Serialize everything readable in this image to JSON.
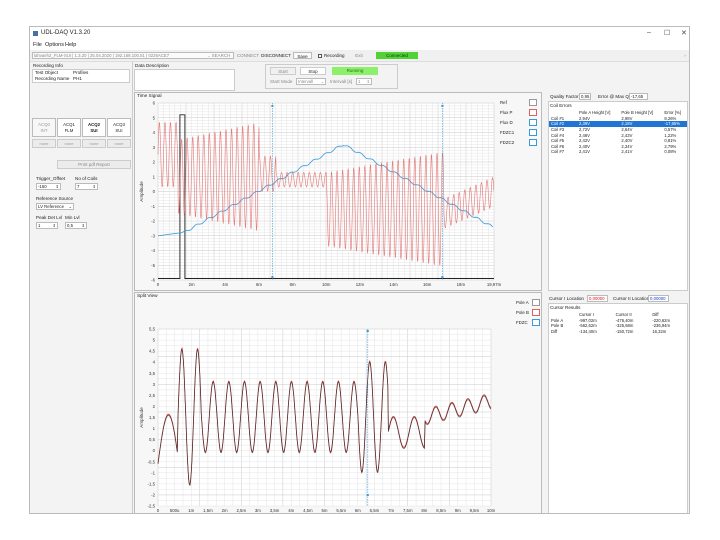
{
  "window": {
    "title": "UDL-DAQ V1.3.20",
    "min_glyph": "–",
    "max_glyph": "☐",
    "close_glyph": "✕"
  },
  "menu": [
    "File",
    "Options",
    "Help"
  ],
  "toolbar": {
    "device": "lahvaeh2_FLM-SUI | 1.3.20 | 25.04.2020 | 192.168.100.51 | 0225ACE7",
    "search": "SEARCH",
    "connect": "CONNECT",
    "disconnect": "DISCONNECT",
    "save": "Save",
    "recording": "Recording",
    "exit": "Exit",
    "status": "Connected"
  },
  "recording_info": {
    "title": "Recording Info",
    "test_object_label": "Test Object",
    "test_object_value": "Profiles",
    "recording_name_label": "Recording Name",
    "recording_name_value": "PH1"
  },
  "acq_buttons": [
    {
      "line1": "ACQ0",
      "line2": "INT"
    },
    {
      "line1": "ACQ1",
      "line2": "FLM"
    },
    {
      "line1": "ACQ2",
      "line2": "SUI"
    },
    {
      "line1": "ACQ3",
      "line2": "SUI"
    }
  ],
  "none_label": "none",
  "print_report": "Print pdf Report",
  "trigger": {
    "offset_label": "Trigger_Offset",
    "offset_value": "-150",
    "coils_label": "No of Coils",
    "coils_value": "7",
    "ref_label": "Reference Source",
    "ref_value": "LV Reference",
    "peak_label": "Peak Det Lvl",
    "peak_value": "1",
    "min_label": "Min Lvl",
    "min_value": "0,5"
  },
  "data_description_title": "Data Description",
  "controls": {
    "start": "Start",
    "stop": "Stop",
    "running": "Running",
    "start_mode_label": "Start Mode",
    "start_mode_value": "Intervall",
    "interval_label": "Intervall [s]",
    "interval_value": "1"
  },
  "time_signal": {
    "title": "Time Signal",
    "ylabel": "Amplitude",
    "yticks": [
      "6",
      "5",
      "4",
      "3",
      "2",
      "1",
      "0",
      "-1",
      "-2",
      "-3",
      "-4",
      "-5",
      "-6"
    ],
    "xticks": [
      "0",
      "2m",
      "4m",
      "6m",
      "8m",
      "10m",
      "12m",
      "14m",
      "16m",
      "18m",
      "19,97m"
    ],
    "legend": [
      "Ref",
      "Flux P",
      "Flux D",
      "FDZC1",
      "FDZC2"
    ]
  },
  "quality": {
    "qf_label": "Quality Factor",
    "qf_value": "0,95",
    "err_label": "Error @ Max QF",
    "err_value": "-17,65"
  },
  "coil_errors": {
    "title": "Coil Errors",
    "headers": [
      "",
      "Pole A Height [V]",
      "Pole B Height [V]",
      "Error [%]"
    ],
    "rows": [
      [
        "Coil #1",
        "2,94V",
        "2,98V",
        "8,26%"
      ],
      [
        "Coil #2",
        "2,39V",
        "2,18V",
        "-17,65%"
      ],
      [
        "Coil #3",
        "2,72V",
        "2,64V",
        "0,57%"
      ],
      [
        "Coil #4",
        "2,46V",
        "2,43V",
        "1,22%"
      ],
      [
        "Coil #5",
        "2,42V",
        "2,40V",
        "0,81%"
      ],
      [
        "Coil #6",
        "2,40V",
        "2,34V",
        "2,79%"
      ],
      [
        "Coil #7",
        "2,41V",
        "2,41V",
        "0,08%"
      ]
    ],
    "selected_row": 1
  },
  "split_view": {
    "title": "Split View",
    "ylabel": "Amplitude",
    "yticks": [
      "5,5",
      "5",
      "4,5",
      "4",
      "3,5",
      "3",
      "2,5",
      "2",
      "1,5",
      "1",
      "0,5",
      "0",
      "-0,5",
      "-1",
      "-1,5",
      "-2",
      "-2,5"
    ],
    "xticks": [
      "0",
      "500u",
      "1m",
      "1,5m",
      "2m",
      "2,5m",
      "3m",
      "3,5m",
      "4m",
      "4,5m",
      "5m",
      "5,5m",
      "6m",
      "6,5m",
      "7m",
      "7,5m",
      "8m",
      "8,5m",
      "9m",
      "9,5m",
      "10m"
    ],
    "legend": [
      "Pole A",
      "Pole B",
      "FDZC"
    ]
  },
  "cursor": {
    "c1_label": "Cursor I Location",
    "c1_value": "0,00000",
    "c2_label": "Cursor II Location",
    "c2_value": "0,00000",
    "results_title": "Cursor Results",
    "headers": [
      "",
      "Cursor I",
      "Cursor II",
      "Diff"
    ],
    "rows": [
      [
        "Pole A",
        "-997,02m",
        "-476,40m",
        "-220,62m"
      ],
      [
        "Pole B",
        "-562,62m",
        "-325,68m",
        "-236,94m"
      ],
      [
        "Diff",
        "-134,40m",
        "-150,72m",
        "16,32m"
      ]
    ]
  },
  "colors": {
    "accent": "#1f74d4",
    "connected": "#52d236",
    "running": "#8cf06a",
    "flux_p": "#e06060",
    "flux_d": "#3a9ad9",
    "ref": "#222222",
    "pole_a": "#cc3333",
    "pole_b": "#333333"
  }
}
